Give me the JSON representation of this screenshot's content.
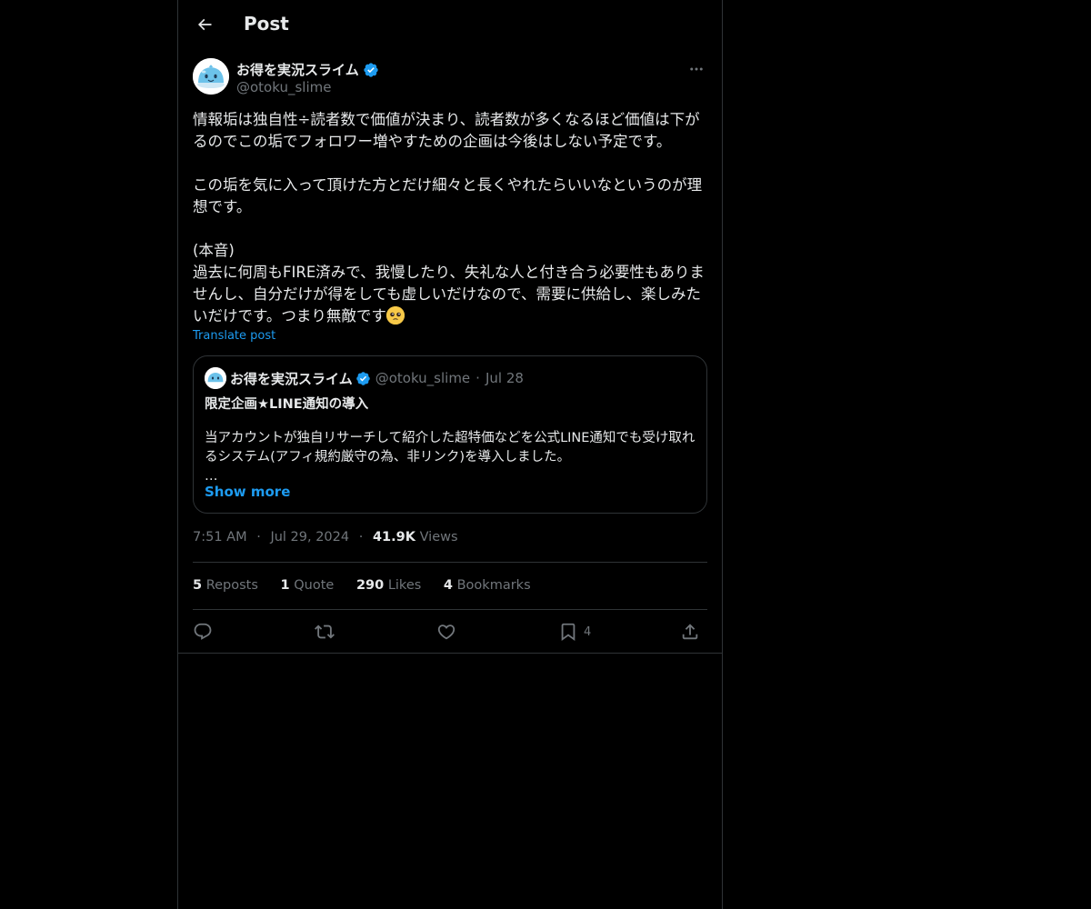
{
  "header": {
    "title": "Post"
  },
  "author": {
    "name": "お得を実況スライム",
    "handle": "@otoku_slime"
  },
  "post": {
    "text": "情報垢は独自性÷読者数で価値が決まり、読者数が多くなるほど価値は下がるのでこの垢でフォロワー増やすための企画は今後はしない予定です。\n\nこの垢を気に入って頂けた方とだけ細々と長くやれたらいいなというのが理想です。\n\n(本音)\n過去に何周もFIRE済みで、我慢したり、失礼な人と付き合う必要性もありませんし、自分だけが得をしても虚しいだけなので、需要に供給し、楽しみたいだけです。つまり無敵です",
    "translate_label": "Translate post"
  },
  "quote": {
    "name": "お得を実況スライム",
    "handle": "@otoku_slime",
    "separator": "·",
    "date": "Jul 28",
    "title": "限定企画★LINE通知の導入",
    "text": "当アカウントが独自リサーチして紹介した超特価などを公式LINE通知でも受け取れるシステム(アフィ規約厳守の為、非リンク)を導入しました。\n…",
    "show_more": "Show more"
  },
  "meta": {
    "time": "7:51 AM",
    "sep": "·",
    "date": "Jul 29, 2024",
    "views_count": "41.9K",
    "views_label": "Views"
  },
  "stats": [
    {
      "count": "5",
      "label": "Reposts"
    },
    {
      "count": "1",
      "label": "Quote"
    },
    {
      "count": "290",
      "label": "Likes"
    },
    {
      "count": "4",
      "label": "Bookmarks"
    }
  ],
  "actions": {
    "bookmark_count": "4"
  },
  "colors": {
    "background": "#000000",
    "accent": "#1d9bf0",
    "text": "#e7e9ea",
    "muted": "#71767b",
    "border": "#2f3336"
  },
  "icons": [
    "back-arrow-icon",
    "verified-badge-icon",
    "more-icon",
    "reply-icon",
    "repost-icon",
    "like-icon",
    "bookmark-icon",
    "share-icon"
  ]
}
